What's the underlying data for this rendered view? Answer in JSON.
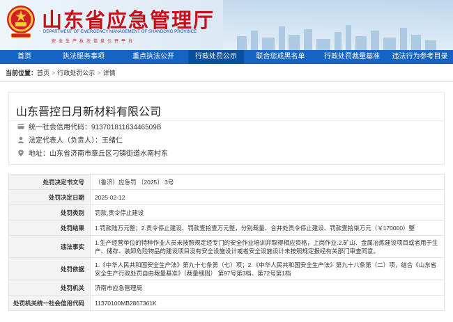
{
  "header": {
    "title": "山东省应急管理厅",
    "title_en": "DEPARTMENT OF EMERGENCY MANAGEMENT OF SHANDONG PROVINCE",
    "slogan": "安全生产执法信息公开平台"
  },
  "nav": {
    "items": [
      {
        "label": "首页"
      },
      {
        "label": "执法服务事项"
      },
      {
        "label": "重点执法公开"
      },
      {
        "label": "行政处罚公示",
        "active": true
      },
      {
        "label": "联合惩戒黑名单"
      },
      {
        "label": "行政处罚裁量基准"
      },
      {
        "label": "违法行为参考目录"
      }
    ]
  },
  "breadcrumb": {
    "label": "当前位置：",
    "items": [
      "首页",
      "行政处罚公示",
      "详情"
    ]
  },
  "company": {
    "name": "山东晋控日月新材料有限公司",
    "credit_label": "统一社会信用代码：",
    "credit_code": "91370181163446509B",
    "rep_label": "法定代表人（负责人）：",
    "rep_name": "王绪仁",
    "address_label": "地址：",
    "address": "山东省济南市章丘区刁镇街道水南村东"
  },
  "details": {
    "rows": [
      {
        "label": "处罚决定书文号",
        "value": "（鲁济）应急罚 〔2025〕 3号"
      },
      {
        "label": "处罚决定日期",
        "value": "2025-02-12"
      },
      {
        "label": "处罚类别",
        "value": "罚款,责令停止建设"
      },
      {
        "label": "处罚结果",
        "value": "1.罚款陆万元整；2.责令停止建设、罚款壹拾壹万元整，分别裁量、合并处责令停止建设、罚款壹拾柒万元（￥170000）整"
      },
      {
        "label": "违法事实",
        "value": "1.生产经营单位的特种作业人员未按照规定经专门的安全作业培训并取得相应资格，上岗作业.2.矿山、金属冶炼建设项目或者用于生产、储存、装卸危险物品的建设项目没有安全设施设计或者安全设施设计未按照规定报经有关部门审查同意。"
      },
      {
        "label": "处罚依据",
        "value": "1.《中华人民共和国安全生产法》第九十七条第（七）项；2.《中华人民共和国安全生产法》第九十八条第（二）项，结合《山东省安全生产行政处罚自由裁量基准》（裁量细则） 第97号第3档、第72号第1档"
      },
      {
        "label": "处罚机关",
        "value": "济南市应急管理局"
      },
      {
        "label": "处罚机关统一社会信用代码",
        "value": "11370100MB2867361K"
      }
    ]
  },
  "colors": {
    "nav_bg": "#1563c2",
    "title_red": "#c4121b",
    "label_bg": "#f3f3f3"
  }
}
